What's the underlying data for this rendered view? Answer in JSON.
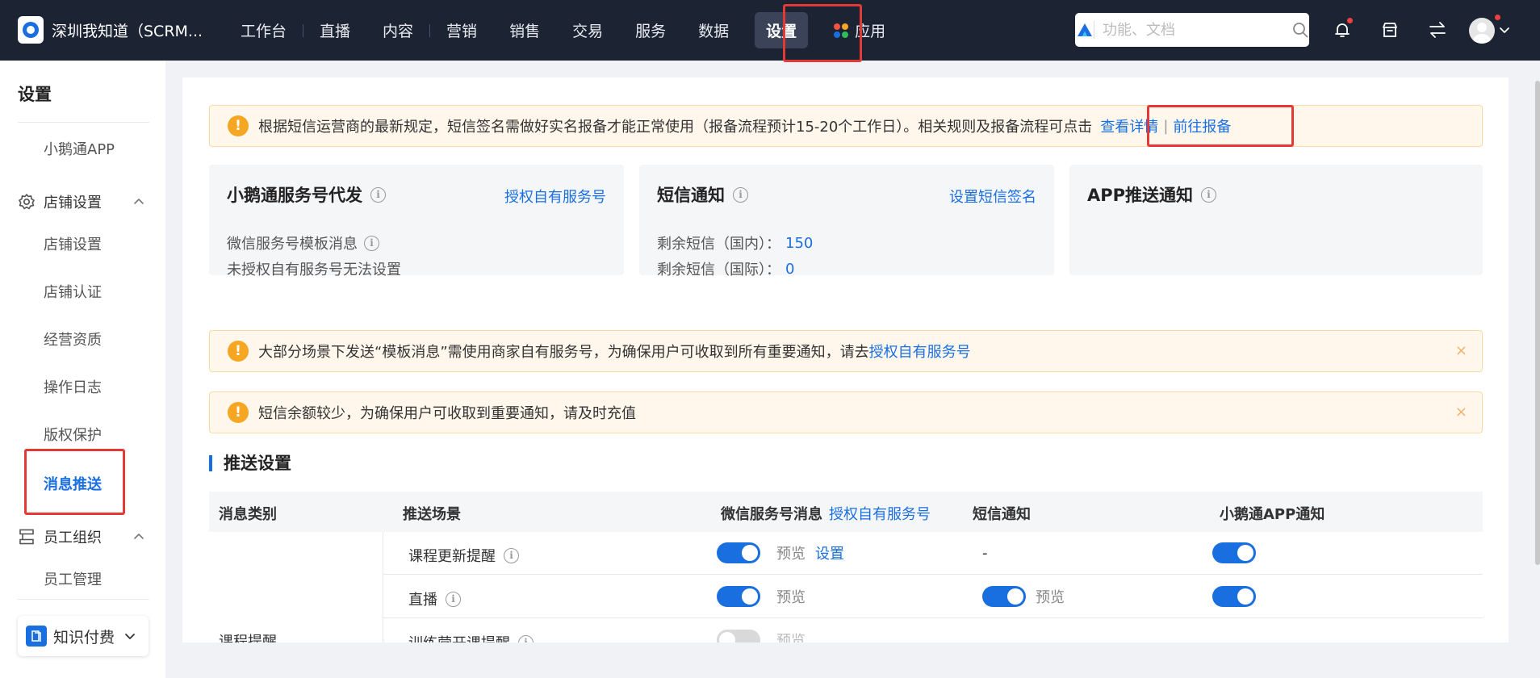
{
  "topbar": {
    "shop_name": "深圳我知道（SCRM...",
    "nav": [
      "工作台",
      "直播",
      "内容",
      "营销",
      "销售",
      "交易",
      "服务",
      "数据",
      "设置",
      "应用"
    ],
    "search_placeholder": "功能、文档"
  },
  "sidebar": {
    "title": "设置",
    "app": "小鹅通APP",
    "group_shop": "店铺设置",
    "shop_items": [
      "店铺设置",
      "店铺认证",
      "经营资质",
      "操作日志",
      "版权保护",
      "消息推送"
    ],
    "group_staff": "员工组织",
    "staff_items": [
      "员工管理"
    ],
    "product_switch": "知识付费"
  },
  "notice1": {
    "text": "根据短信运营商的最新规定，短信签名需做好实名报备才能正常使用（报备流程预计15-20个工作日）。相关规则及报备流程可点击",
    "link1": "查看详情",
    "sep": "|",
    "link2": "前往报备"
  },
  "cards": {
    "service": {
      "title": "小鹅通服务号代发",
      "link": "授权自有服务号",
      "line1": "微信服务号模板消息",
      "line2": "未授权自有服务号无法设置"
    },
    "sms": {
      "title": "短信通知",
      "link": "设置短信签名",
      "domestic_label": "剩余短信（国内）：",
      "domestic_value": "150",
      "intl_label": "剩余短信（国际）：",
      "intl_value": "0"
    },
    "app": {
      "title": "APP推送通知"
    }
  },
  "notice2": {
    "text": "大部分场景下发送“模板消息”需使用商家自有服务号，为确保用户可收取到所有重要通知，请去",
    "link": "授权自有服务号",
    "close": "×"
  },
  "notice3": {
    "text": "短信余额较少，为确保用户可收取到重要通知，请及时充值",
    "close": "×"
  },
  "section_title": "推送设置",
  "table": {
    "headers": {
      "type": "消息类别",
      "scene": "推送场景",
      "wechat": "微信服务号消息",
      "wechat_link": "授权自有服务号",
      "sms": "短信通知",
      "app": "小鹅通APP通知"
    },
    "category": "课程提醒",
    "rows": [
      {
        "scene": "课程更新提醒",
        "wechat_on": true,
        "preview": "预览",
        "setting": "设置",
        "sms": "-",
        "app_on": true
      },
      {
        "scene": "直播",
        "wechat_on": true,
        "preview": "预览",
        "sms_on": true,
        "sms_preview": "预览",
        "app_on": true
      },
      {
        "scene": "训练营开课提醒",
        "wechat_on": false,
        "preview": "预览"
      }
    ]
  }
}
